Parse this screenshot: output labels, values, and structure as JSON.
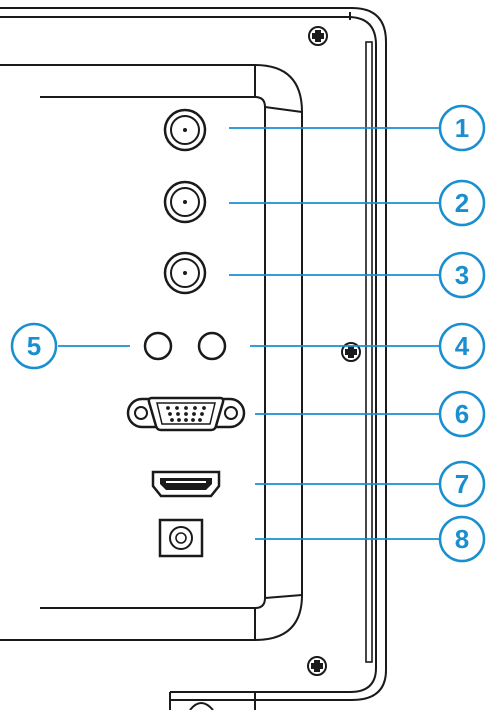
{
  "diagram": {
    "accent_color": "#1a8fd0",
    "line_color": "#1a1a1a",
    "callouts": [
      {
        "number": "1",
        "target": "antenna-connector-top"
      },
      {
        "number": "2",
        "target": "antenna-connector-middle"
      },
      {
        "number": "3",
        "target": "antenna-connector-bottom"
      },
      {
        "number": "4",
        "target": "round-jack-right"
      },
      {
        "number": "5",
        "target": "round-jack-left"
      },
      {
        "number": "6",
        "target": "vga-port"
      },
      {
        "number": "7",
        "target": "hdmi-port"
      },
      {
        "number": "8",
        "target": "dc-power-jack"
      }
    ]
  }
}
